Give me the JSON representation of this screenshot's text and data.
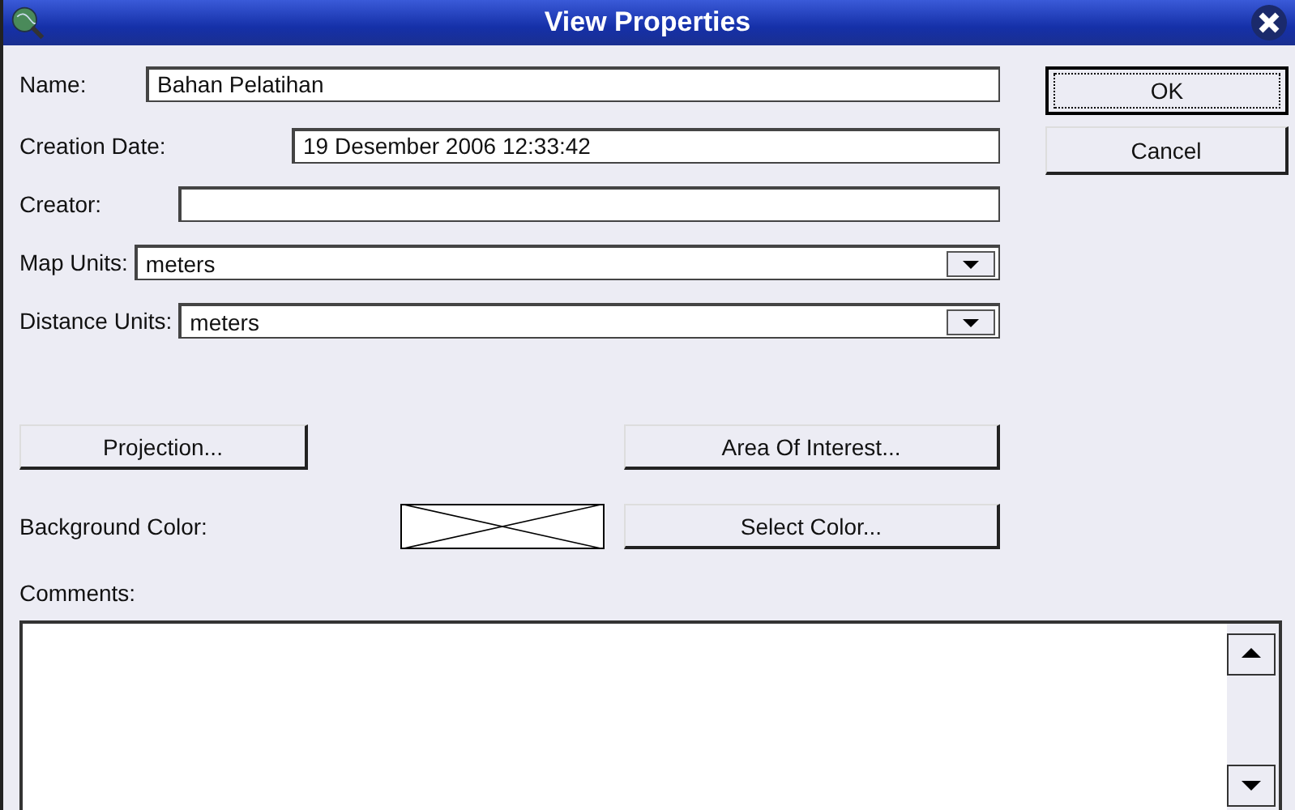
{
  "window": {
    "title": "View Properties"
  },
  "fields": [
    {
      "label": "Name:",
      "value": "Bahan Pelatihan"
    },
    {
      "label": "Creation Date:",
      "value": "19 Desember 2006 12:33:42"
    },
    {
      "label": "Creator:"
    }
  ],
  "dropdowns": [
    {
      "label": "Map Units:",
      "value": "meters"
    },
    {
      "label": "Distance Units:",
      "value": "meters"
    }
  ],
  "dialog_buttons": [
    {
      "label": "OK",
      "focused": true
    },
    {
      "label": "Cancel",
      "focused": false
    }
  ],
  "projection_button": "Projection...",
  "area_button": "Area Of Interest...",
  "background_color": {
    "label": "Background Color:",
    "button": "Select Color..."
  },
  "comments": {
    "label": "Comments:"
  }
}
